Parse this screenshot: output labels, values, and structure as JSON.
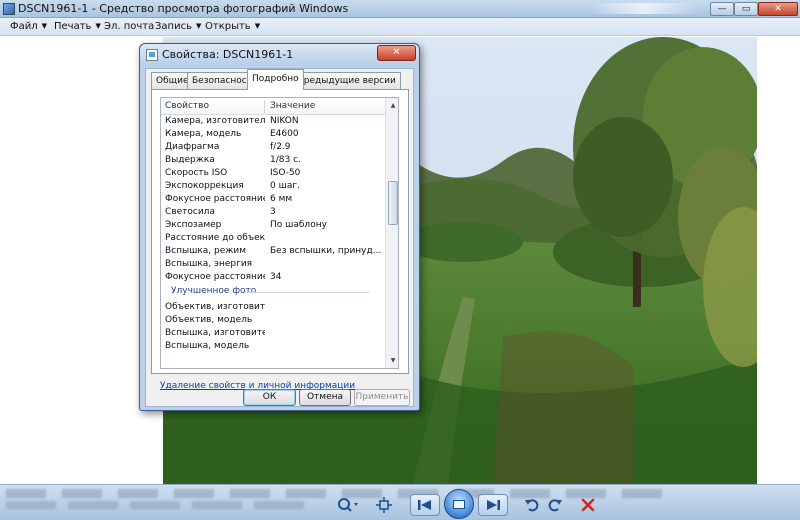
{
  "window": {
    "title": "DSCN1961-1 - Средство просмотра фотографий Windows",
    "controls": {
      "minimize": "—",
      "maximize": "▭",
      "close": "✕"
    }
  },
  "menu": {
    "items": [
      {
        "label": "Файл",
        "has_arrow": true
      },
      {
        "label": "Печать",
        "has_arrow": true
      },
      {
        "label": "Эл. почта",
        "has_arrow": false
      },
      {
        "label": "Запись",
        "has_arrow": true
      },
      {
        "label": "Открыть",
        "has_arrow": true
      }
    ],
    "arrow": "▼"
  },
  "dialog": {
    "title": "Свойства: DSCN1961-1",
    "close": "✕",
    "tabs": [
      {
        "label": "Общие",
        "active": false
      },
      {
        "label": "Безопасность",
        "active": false
      },
      {
        "label": "Подробно",
        "active": true
      },
      {
        "label": "Предыдущие версии",
        "active": false
      }
    ],
    "columns": {
      "property": "Свойство",
      "value": "Значение"
    },
    "rows": [
      {
        "name": "Камера, изготовитель",
        "value": "NIKON"
      },
      {
        "name": "Камера, модель",
        "value": "E4600"
      },
      {
        "name": "Диафрагма",
        "value": "f/2.9"
      },
      {
        "name": "Выдержка",
        "value": "1/83 с."
      },
      {
        "name": "Скорость ISO",
        "value": "ISO-50"
      },
      {
        "name": "Экспокоррекция",
        "value": "0 шаг."
      },
      {
        "name": "Фокусное расстояние",
        "value": "6 мм"
      },
      {
        "name": "Светосила",
        "value": "3"
      },
      {
        "name": "Экспозамер",
        "value": "По шаблону"
      },
      {
        "name": "Расстояние до объекта",
        "value": ""
      },
      {
        "name": "Вспышка, режим",
        "value": "Без вспышки, принуд..."
      },
      {
        "name": "Вспышка, энергия",
        "value": ""
      },
      {
        "name": "Фокусное расстояние, э...",
        "value": "34"
      }
    ],
    "group_label": "Улучшенное фото",
    "rows_after_group": [
      {
        "name": "Объектив, изготовитель",
        "value": ""
      },
      {
        "name": "Объектив, модель",
        "value": ""
      },
      {
        "name": "Вспышка, изготовитель",
        "value": ""
      },
      {
        "name": "Вспышка, модель",
        "value": ""
      }
    ],
    "remove_link": "Удаление свойств и личной информации",
    "buttons": {
      "ok": "ОК",
      "cancel": "Отмена",
      "apply": "Применить"
    },
    "scrollbar": {
      "position": 0.35
    }
  },
  "toolbar": {
    "icons": [
      "zoom-icon",
      "fit-icon",
      "previous-icon",
      "slideshow-icon",
      "next-icon",
      "rotate-left-icon",
      "rotate-right-icon",
      "delete-icon"
    ]
  },
  "colors": {
    "titlebar": "#b6cde8",
    "accent": "#3f86d6",
    "link": "#0645ad",
    "delete": "#d0281c"
  }
}
